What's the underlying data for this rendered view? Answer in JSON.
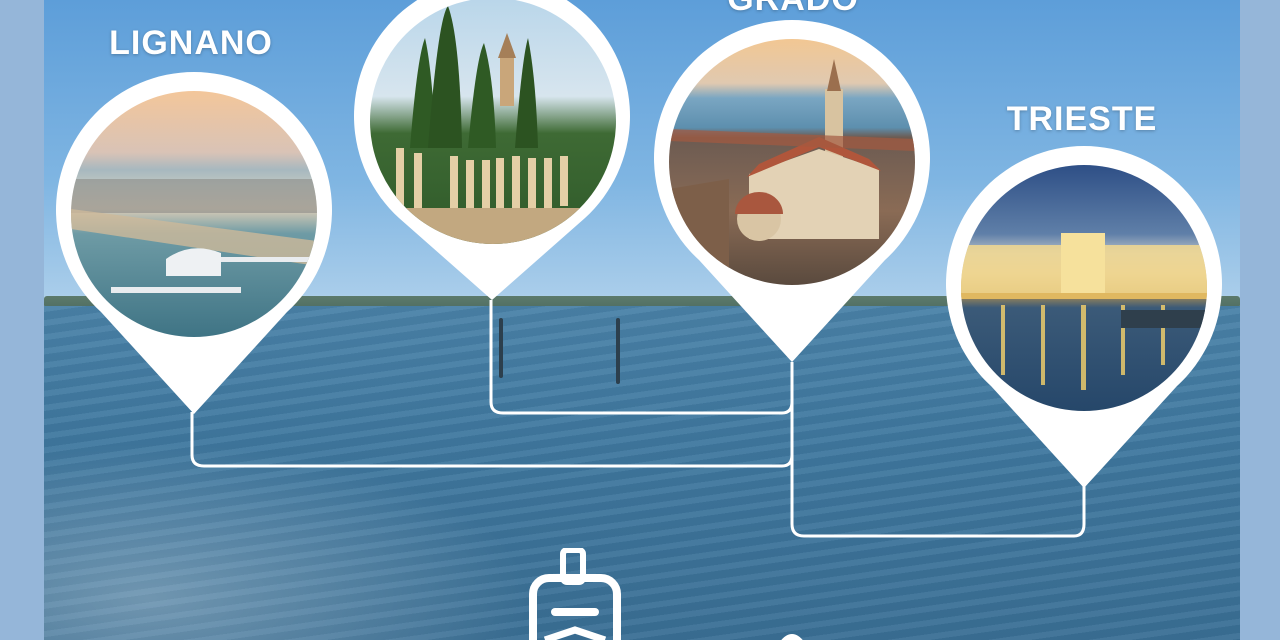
{
  "destinations": [
    {
      "name": "LIGNANO",
      "color": "#ffffff"
    },
    {
      "name": "",
      "color": "#ffffff"
    },
    {
      "name": "GRADO",
      "color": "#ffffff"
    },
    {
      "name": "TRIESTE",
      "color": "#ffffff"
    }
  ],
  "icons": {
    "ferry": "ferry-icon",
    "arrow": "arrow-icon"
  },
  "colors": {
    "sky": "#7fb5e2",
    "sea": "#3f789f",
    "pin": "#ffffff",
    "frame": "#95b6d9"
  }
}
